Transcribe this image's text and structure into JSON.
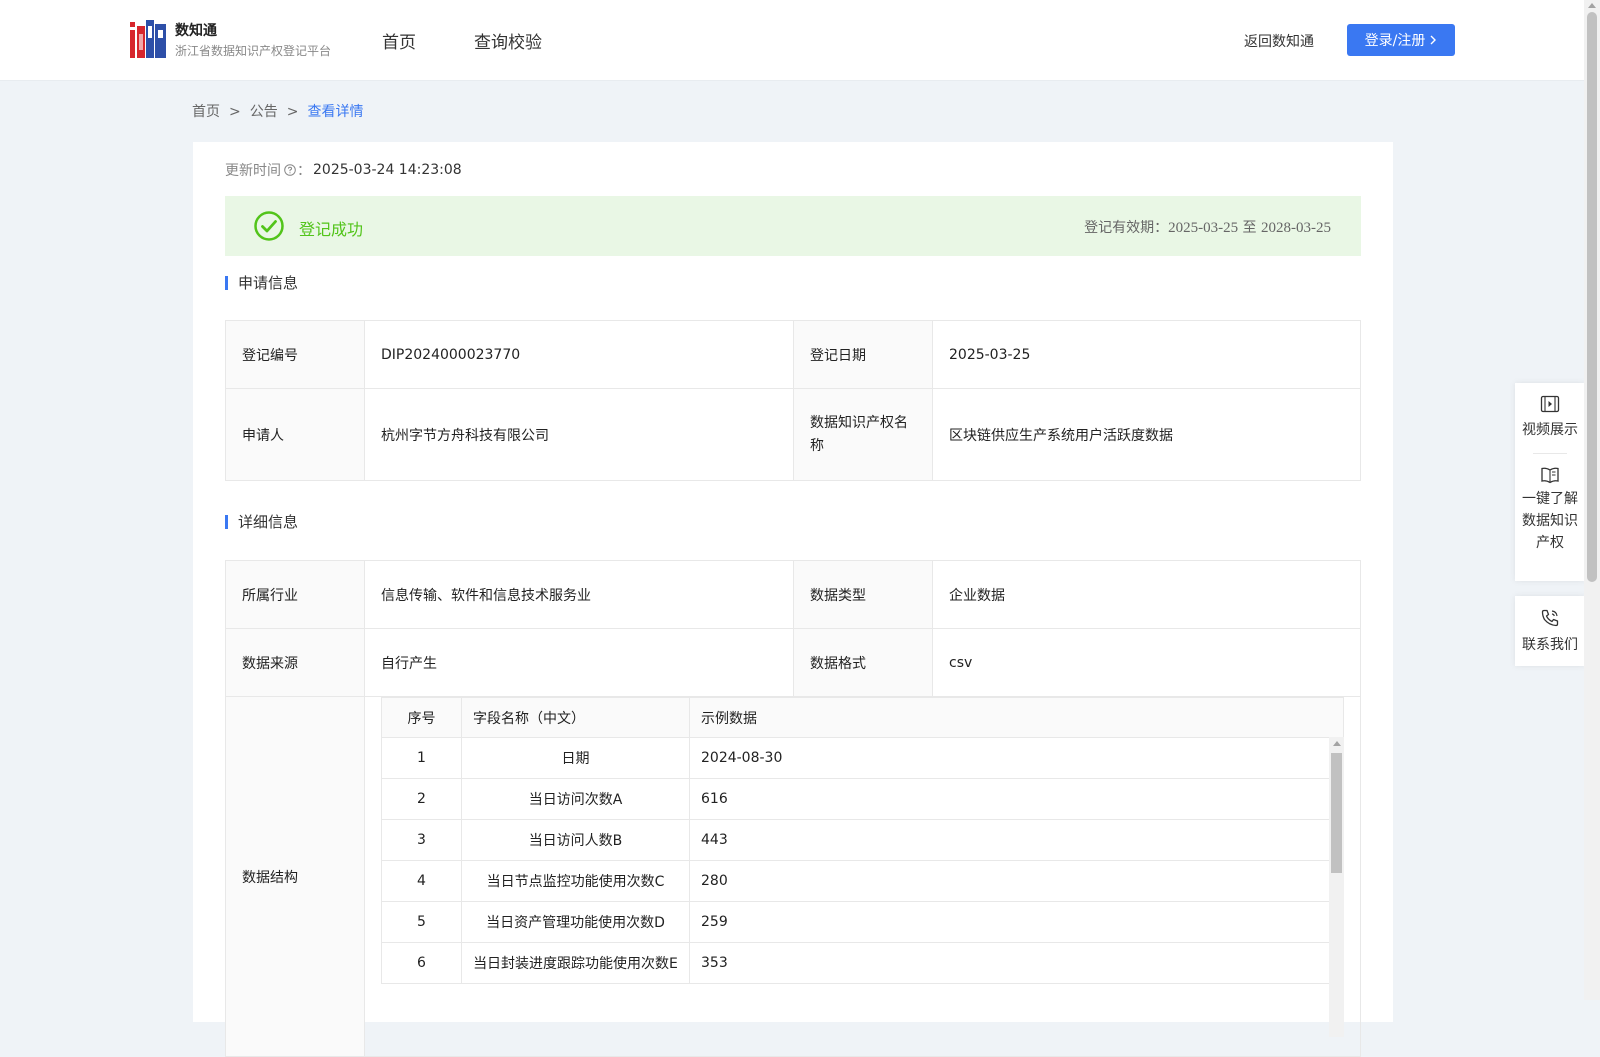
{
  "header": {
    "brand_name": "数知通",
    "brand_sub": "浙江省数据知识产权登记平台",
    "nav": [
      "首页",
      "查询校验"
    ],
    "back_link": "返回数知通",
    "login_label": "登录/注册"
  },
  "breadcrumb": [
    "首页",
    "公告",
    "查看详情"
  ],
  "update": {
    "label": "更新时间",
    "colon": "：",
    "value": "2025-03-24 14:23:08"
  },
  "status": {
    "text": "登记成功",
    "validity_label": "登记有效期：",
    "validity_start": "2025-03-25",
    "validity_mid": " 至 ",
    "validity_end": "2028-03-25",
    "color": "#52c41a"
  },
  "apply_section": {
    "title": "申请信息",
    "rows": [
      {
        "label1": "登记编号",
        "value1": "DIP2024000023770",
        "label2": "登记日期",
        "value2": "2025-03-25"
      },
      {
        "label1": "申请人",
        "value1": "杭州字节方舟科技有限公司",
        "label2": "数据知识产权名称",
        "value2": "区块链供应生产系统用户活跃度数据"
      }
    ]
  },
  "detail_section": {
    "title": "详细信息",
    "rows": [
      {
        "label1": "所属行业",
        "value1": "信息传输、软件和信息技术服务业",
        "label2": "数据类型",
        "value2": "企业数据"
      },
      {
        "label1": "数据来源",
        "value1": "自行产生",
        "label2": "数据格式",
        "value2": "csv"
      }
    ],
    "structure_label": "数据结构",
    "structure_headers": [
      "序号",
      "字段名称（中文）",
      "示例数据"
    ],
    "structure_rows": [
      {
        "no": "1",
        "name": "日期",
        "sample": "2024-08-30"
      },
      {
        "no": "2",
        "name": "当日访问次数A",
        "sample": "616"
      },
      {
        "no": "3",
        "name": "当日访问人数B",
        "sample": "443"
      },
      {
        "no": "4",
        "name": "当日节点监控功能使用次数C",
        "sample": "280"
      },
      {
        "no": "5",
        "name": "当日资产管理功能使用次数D",
        "sample": "259"
      },
      {
        "no": "6",
        "name": "当日封装进度跟踪功能使用次数E",
        "sample": "353"
      }
    ]
  },
  "side_panel": {
    "video": "视频展示",
    "learn": [
      "一键了解",
      "数据知识",
      "产权"
    ],
    "contact": "联系我们"
  },
  "colors": {
    "accent": "#3a78f2",
    "banner_bg": "#e9f7e5",
    "page_bg": "#eff3f7"
  }
}
